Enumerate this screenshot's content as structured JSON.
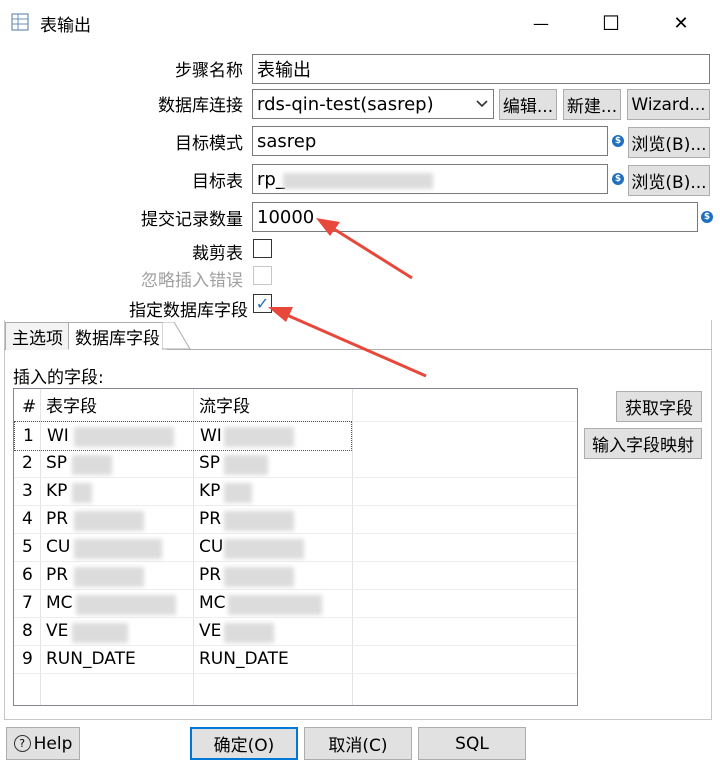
{
  "window": {
    "title": "表输出",
    "minimize_glyph": "—",
    "maximize_glyph": "☐",
    "close_glyph": "✕"
  },
  "form": {
    "step_name_label": "步骤名称",
    "step_name_value": "表输出",
    "connection_label": "数据库连接",
    "connection_value": "rds-qin-test(sasrep)",
    "edit_button": "编辑...",
    "new_button": "新建...",
    "wizard_button": "Wizard...",
    "schema_label": "目标模式",
    "schema_value": "sasrep",
    "browse_button": "浏览(B)...",
    "target_table_label": "目标表",
    "target_table_value": "rp_",
    "commit_size_label": "提交记录数量",
    "commit_size_value": "10000",
    "truncate_label": "裁剪表",
    "ignore_errors_label": "忽略插入错误",
    "specify_fields_label": "指定数据库字段",
    "var_icon_glyph": "$",
    "checkmark_glyph": "✓"
  },
  "tabs": [
    {
      "label": "主选项"
    },
    {
      "label": "数据库字段"
    }
  ],
  "fields_panel": {
    "inserted_fields_label": "插入的字段:",
    "get_fields_button": "获取字段",
    "map_fields_button": "输入字段映射",
    "columns": [
      "#",
      "表字段",
      "流字段"
    ],
    "rows": [
      {
        "num": "1",
        "table_field": "WI",
        "stream_field": "WI"
      },
      {
        "num": "2",
        "table_field": "SP",
        "stream_field": "SP"
      },
      {
        "num": "3",
        "table_field": "KP",
        "stream_field": "KP"
      },
      {
        "num": "4",
        "table_field": "PR",
        "stream_field": "PR"
      },
      {
        "num": "5",
        "table_field": "CU",
        "stream_field": "CU"
      },
      {
        "num": "6",
        "table_field": "PR",
        "stream_field": "PR"
      },
      {
        "num": "7",
        "table_field": "MC",
        "stream_field": "MC"
      },
      {
        "num": "8",
        "table_field": "VE",
        "stream_field": "VE"
      },
      {
        "num": "9",
        "table_field": "RUN_DATE",
        "stream_field": "RUN_DATE"
      }
    ]
  },
  "footer": {
    "help_button": "Help",
    "help_glyph": "?",
    "ok_button": "确定(O)",
    "cancel_button": "取消(C)",
    "sql_button": "SQL"
  },
  "colors": {
    "accent": "#1f6fc0",
    "annotation_arrow": "#e8473b"
  }
}
